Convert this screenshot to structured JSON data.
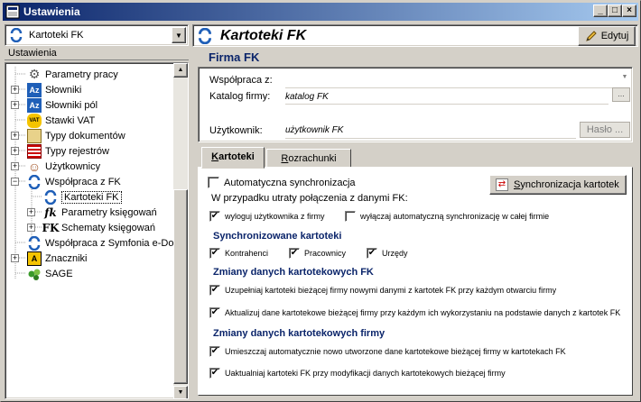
{
  "window": {
    "title": "Ustawienia",
    "controls": [
      "_",
      "□",
      "×"
    ]
  },
  "left": {
    "module_select": "Kartoteki FK",
    "tree_header": "Ustawienia",
    "items": [
      {
        "label": "Parametry pracy",
        "icon": "gear-icon",
        "glyph": "⚙"
      },
      {
        "label": "Słowniki",
        "icon": "dictionary-icon",
        "glyph": "Az"
      },
      {
        "label": "Słowniki pól",
        "icon": "dictionary-icon",
        "glyph": "Az"
      },
      {
        "label": "Stawki VAT",
        "icon": "vat-icon",
        "glyph": "VAT"
      },
      {
        "label": "Typy dokumentów",
        "icon": "folder-icon",
        "glyph": "▭"
      },
      {
        "label": "Typy rejestrów",
        "icon": "register-icon",
        "glyph": "▦"
      },
      {
        "label": "Użytkownicy",
        "icon": "users-icon",
        "glyph": "☺"
      },
      {
        "label": "Współpraca z FK",
        "icon": "sync-icon",
        "glyph": "S"
      },
      {
        "label": "Kartoteki FK",
        "icon": "sync-icon",
        "glyph": "S"
      },
      {
        "label": "Parametry księgowań",
        "icon": "fk-icon",
        "glyph": "fk"
      },
      {
        "label": "Schematy księgowań",
        "icon": "fk-icon",
        "glyph": "FK"
      },
      {
        "label": "Współpraca z Symfonia e-Do",
        "icon": "sync-icon",
        "glyph": "S"
      },
      {
        "label": "Znaczniki",
        "icon": "marker-icon",
        "glyph": "A"
      },
      {
        "label": "SAGE",
        "icon": "sage-icon",
        "glyph": "●"
      }
    ]
  },
  "right": {
    "title": "Kartoteki FK",
    "edit_label": "Edytuj",
    "firm_title": "Firma FK",
    "fields": {
      "coop_label": "Współpraca z:",
      "coop_value": "",
      "catalog_label": "Katalog firmy:",
      "catalog_value": "katalog FK",
      "catalog_btn": "...",
      "user_label": "Użytkownik:",
      "user_value": "użytkownik FK",
      "password_btn": "Hasło ..."
    },
    "tabs": [
      "Kartoteki",
      "Rozrachunki"
    ],
    "tab_accel": {
      "first_k": "K",
      "first_rest": "artoteki",
      "second_r": "R",
      "second_rest": "ozrachunki"
    },
    "auto_sync": {
      "label": "Automatyczna synchronizacja",
      "checked": false
    },
    "sync_button": {
      "pre": "",
      "accel": "S",
      "rest": "ynchronizacja kartotek"
    },
    "lost_conn": "W przypadku utraty połączenia z danymi FK:",
    "logout": {
      "label": "wyloguj użytkownika z firmy",
      "checked": true
    },
    "disable_auto": {
      "label": "wyłączaj automatyczną synchronizację w całej firmie",
      "checked": false
    },
    "sync_title": "Synchronizowane kartoteki",
    "kontrahenci": {
      "label": "Kontrahenci",
      "checked": true
    },
    "pracownicy": {
      "label": "Pracownicy",
      "checked": true
    },
    "urzedy": {
      "label": "Urzędy",
      "checked": true
    },
    "changes_fk_title": "Zmiany danych kartotekowych FK",
    "fill": {
      "label": "Uzupełniaj kartoteki bieżącej firmy nowymi danymi z kartotek FK przy każdym otwarciu firmy",
      "checked": true
    },
    "update": {
      "label": "Aktualizuj dane kartotekowe bieżącej firmy przy każdym ich wykorzystaniu na podstawie danych z kartotek FK",
      "checked": true
    },
    "changes_firm_title": "Zmiany danych kartotekowych firmy",
    "place": {
      "label": "Umieszczaj automatycznie nowo utworzone dane kartotekowe bieżącej firmy w kartotekach FK",
      "checked": true
    },
    "refresh": {
      "label": "Uaktualniaj kartoteki FK przy modyfikacji danych kartotekowych bieżącej firmy",
      "checked": true
    },
    "check_glyph": "✔"
  }
}
